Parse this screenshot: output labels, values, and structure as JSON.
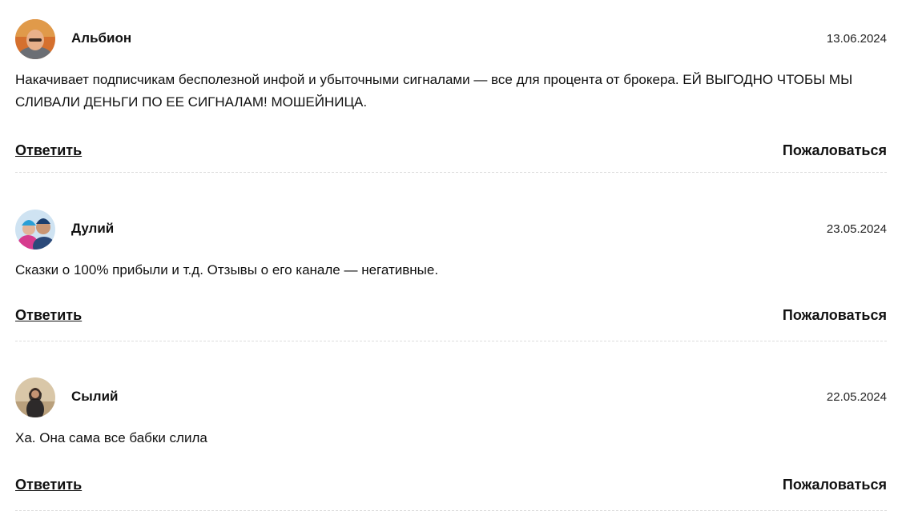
{
  "comments": [
    {
      "author": "Альбион",
      "date": "13.06.2024",
      "text": "Накачивает подписчикам бесполезной инфой и убыточными сигналами — все для процента от брокера. ЕЙ ВЫГОДНО ЧТОБЫ МЫ СЛИВАЛИ ДЕНЬГИ ПО ЕЕ СИГНАЛАМ! МОШЕЙНИЦА.",
      "reply_label": "Ответить",
      "report_label": "Пожаловаться"
    },
    {
      "author": "Дулий",
      "date": "23.05.2024",
      "text": "Сказки о 100% прибыли и т.д. Отзывы о его канале — негативные.",
      "reply_label": "Ответить",
      "report_label": "Пожаловаться"
    },
    {
      "author": "Сылий",
      "date": "22.05.2024",
      "text": "Ха. Она сама все бабки слила",
      "reply_label": "Ответить",
      "report_label": "Пожаловаться"
    }
  ]
}
